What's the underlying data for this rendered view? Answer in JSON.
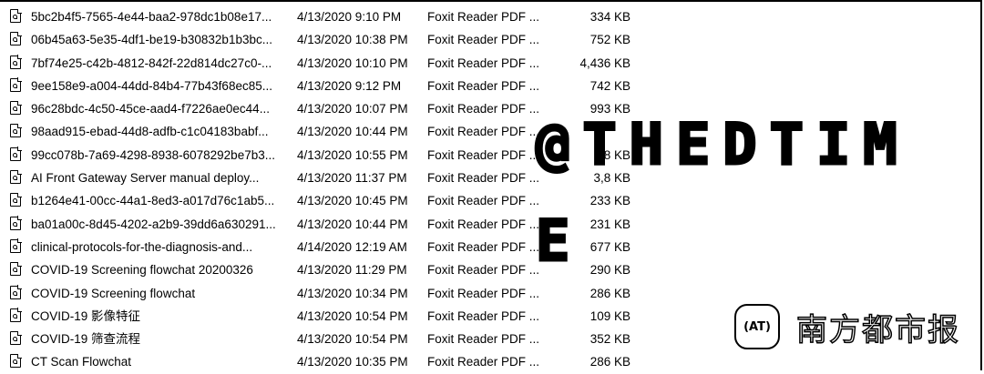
{
  "files": [
    {
      "name": "5bc2b4f5-7565-4e44-baa2-978dc1b08e17...",
      "date": "4/13/2020 9:10 PM",
      "type": "Foxit Reader PDF ...",
      "size": "334 KB"
    },
    {
      "name": "06b45a63-5e35-4df1-be19-b30832b1b3bc...",
      "date": "4/13/2020 10:38 PM",
      "type": "Foxit Reader PDF ...",
      "size": "752 KB"
    },
    {
      "name": "7bf74e25-c42b-4812-842f-22d814dc27c0-...",
      "date": "4/13/2020 10:10 PM",
      "type": "Foxit Reader PDF ...",
      "size": "4,436 KB"
    },
    {
      "name": "9ee158e9-a004-44dd-84b4-77b43f68ec85...",
      "date": "4/13/2020 9:12 PM",
      "type": "Foxit Reader PDF ...",
      "size": "742 KB"
    },
    {
      "name": "96c28bdc-4c50-45ce-aad4-f7226ae0ec44...",
      "date": "4/13/2020 10:07 PM",
      "type": "Foxit Reader PDF ...",
      "size": "993 KB"
    },
    {
      "name": "98aad915-ebad-44d8-adfb-c1c04183babf...",
      "date": "4/13/2020 10:44 PM",
      "type": "Foxit Reader PDF ...",
      "size": ""
    },
    {
      "name": "99cc078b-7a69-4298-8938-6078292be7b3...",
      "date": "4/13/2020 10:55 PM",
      "type": "Foxit Reader PDF ...",
      "size": "8 KB"
    },
    {
      "name": "AI Front Gateway Server manual deploy...",
      "date": "4/13/2020 11:37 PM",
      "type": "Foxit Reader PDF ...",
      "size": "3,8 KB"
    },
    {
      "name": "b1264e41-00cc-44a1-8ed3-a017d76c1ab5...",
      "date": "4/13/2020 10:45 PM",
      "type": "Foxit Reader PDF ...",
      "size": "233 KB"
    },
    {
      "name": "ba01a00c-8d45-4202-a2b9-39dd6a630291...",
      "date": "4/13/2020 10:44 PM",
      "type": "Foxit Reader PDF ...",
      "size": "231 KB"
    },
    {
      "name": "clinical-protocols-for-the-diagnosis-and...",
      "date": "4/14/2020 12:19 AM",
      "type": "Foxit Reader PDF ...",
      "size": "677 KB"
    },
    {
      "name": "COVID-19 Screening flowchat 20200326",
      "date": "4/13/2020 11:29 PM",
      "type": "Foxit Reader PDF ...",
      "size": "290 KB"
    },
    {
      "name": "COVID-19 Screening flowchat",
      "date": "4/13/2020 10:34 PM",
      "type": "Foxit Reader PDF ...",
      "size": "286 KB"
    },
    {
      "name": "COVID-19 影像特征",
      "date": "4/13/2020 10:54 PM",
      "type": "Foxit Reader PDF ...",
      "size": "109 KB"
    },
    {
      "name": "COVID-19 筛查流程",
      "date": "4/13/2020 10:54 PM",
      "type": "Foxit Reader PDF ...",
      "size": "352 KB"
    },
    {
      "name": "CT Scan Flowchat",
      "date": "4/13/2020 10:35 PM",
      "type": "Foxit Reader PDF ...",
      "size": "286 KB"
    }
  ],
  "watermark": {
    "line1": "@THEDTIM",
    "line2": "E",
    "logo_text": "(AT)",
    "brand": "南方都市报"
  }
}
